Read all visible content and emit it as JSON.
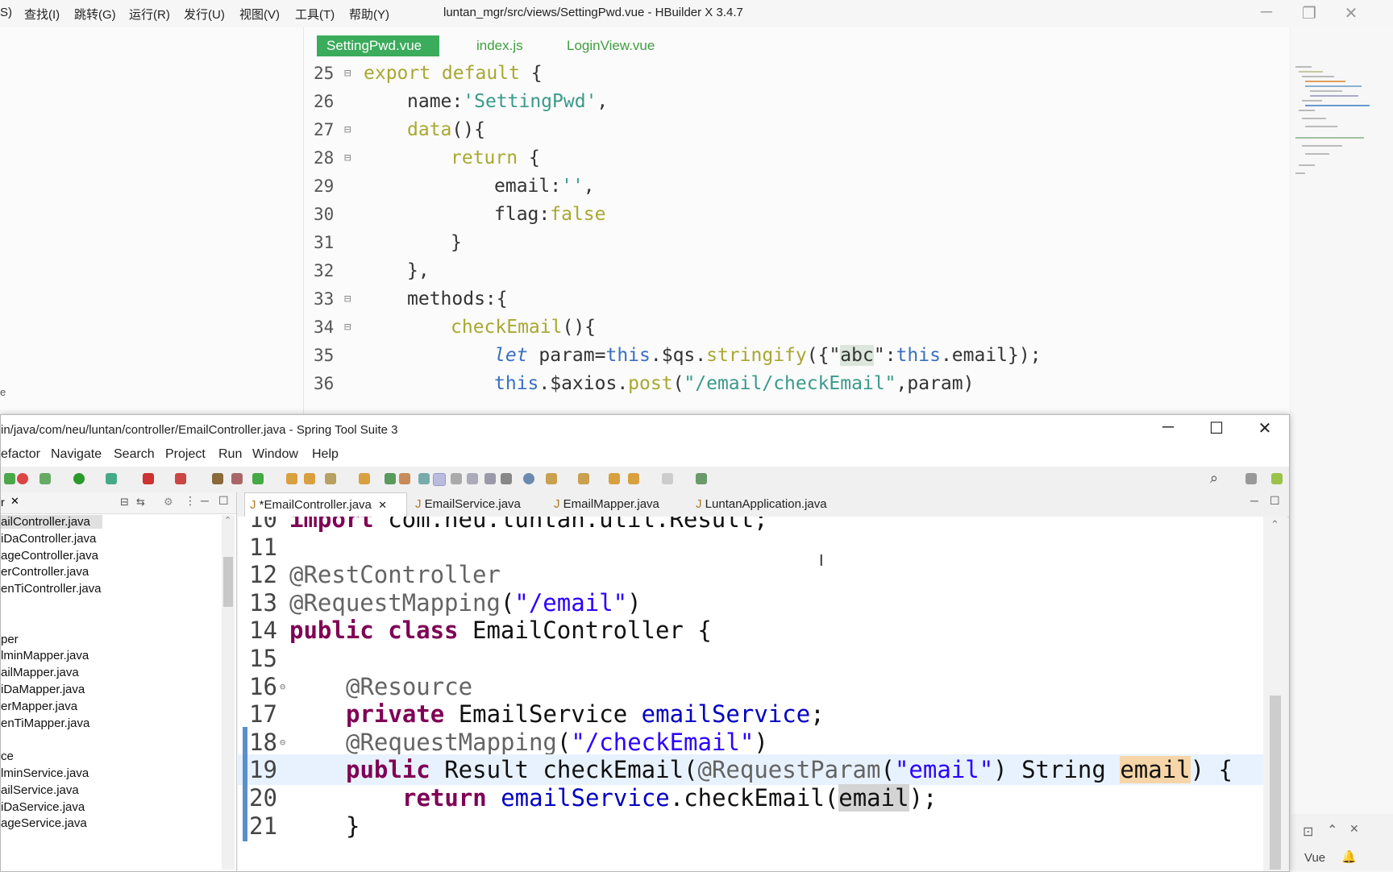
{
  "hbuilder": {
    "menu": [
      "S)",
      "查找(I)",
      "跳转(G)",
      "运行(R)",
      "发行(U)",
      "视图(V)",
      "工具(T)",
      "帮助(Y)"
    ],
    "title": "luntan_mgr/src/views/SettingPwd.vue - HBuilder X 3.4.7",
    "left_fragment": "e",
    "tabs": [
      "SettingPwd.vue",
      "index.js",
      "LoginView.vue"
    ],
    "lines": [
      {
        "n": "25",
        "fold": "⊟",
        "parts": [
          [
            "kw",
            "export default "
          ],
          [
            "t",
            "{"
          ]
        ],
        "indent": 0
      },
      {
        "n": "26",
        "fold": "",
        "parts": [
          [
            "t",
            "name:"
          ],
          [
            "str",
            "'SettingPwd'"
          ],
          [
            "t",
            ","
          ]
        ],
        "indent": 1
      },
      {
        "n": "27",
        "fold": "⊟",
        "parts": [
          [
            "kw",
            "data"
          ],
          [
            "t",
            "(){"
          ]
        ],
        "indent": 1
      },
      {
        "n": "28",
        "fold": "⊟",
        "parts": [
          [
            "kw",
            "return "
          ],
          [
            "t",
            "{"
          ]
        ],
        "indent": 2
      },
      {
        "n": "29",
        "fold": "",
        "parts": [
          [
            "t",
            "email:"
          ],
          [
            "str",
            "''"
          ],
          [
            "t",
            ","
          ]
        ],
        "indent": 3
      },
      {
        "n": "30",
        "fold": "",
        "parts": [
          [
            "t",
            "flag:"
          ],
          [
            "kw",
            "false"
          ]
        ],
        "indent": 3
      },
      {
        "n": "31",
        "fold": "",
        "parts": [
          [
            "t",
            "}"
          ]
        ],
        "indent": 2
      },
      {
        "n": "32",
        "fold": "",
        "parts": [
          [
            "t",
            "},"
          ]
        ],
        "indent": 1
      },
      {
        "n": "33",
        "fold": "⊟",
        "parts": [
          [
            "t",
            "methods:{"
          ]
        ],
        "indent": 1
      },
      {
        "n": "34",
        "fold": "⊟",
        "parts": [
          [
            "kw",
            "checkEmail"
          ],
          [
            "t",
            "(){"
          ]
        ],
        "indent": 2
      },
      {
        "n": "35",
        "fold": "",
        "parts": [
          [
            "it",
            "let "
          ],
          [
            "t",
            "param="
          ],
          [
            "blue",
            "this"
          ],
          [
            "t",
            ".$qs."
          ],
          [
            "kw",
            "stringify"
          ],
          [
            "t",
            "({\""
          ],
          [
            "hl",
            "abc"
          ],
          [
            "t",
            "\":"
          ],
          [
            "blue",
            "this"
          ],
          [
            "t",
            ".email});"
          ]
        ],
        "indent": 3
      },
      {
        "n": "36",
        "fold": "",
        "parts": [
          [
            "blue",
            "this"
          ],
          [
            "t",
            ".$axios."
          ],
          [
            "kw",
            "post"
          ],
          [
            "t",
            "("
          ],
          [
            "str",
            "\"/email/checkEmail\""
          ],
          [
            "t",
            ",param)"
          ]
        ],
        "indent": 3
      }
    ],
    "status_lang": "Vue"
  },
  "sts": {
    "title": "in/java/com/neu/luntan/controller/EmailController.java - Spring Tool Suite 3",
    "menu": [
      "efactor",
      "Navigate",
      "Search",
      "Project",
      "Run",
      "Window",
      "Help"
    ],
    "left_tab_fragment": "r",
    "tree": [
      "ailController.java",
      "iDaController.java",
      "ageController.java",
      "erController.java",
      "enTiController.java",
      "",
      "",
      "per",
      "lminMapper.java",
      "ailMapper.java",
      "iDaMapper.java",
      "erMapper.java",
      "enTiMapper.java",
      "",
      "ce",
      "lminService.java",
      "ailService.java",
      "iDaService.java",
      "ageService.java"
    ],
    "tabs": [
      "*EmailController.java",
      "EmailService.java",
      "EmailMapper.java",
      "LuntanApplication.java"
    ],
    "lines": [
      {
        "n": "10",
        "parts": [
          [
            "kw",
            "import "
          ],
          [
            "t",
            "com.neu.luntan.util.Result;"
          ]
        ],
        "indent": 0
      },
      {
        "n": "11",
        "parts": [],
        "indent": 0
      },
      {
        "n": "12",
        "parts": [
          [
            "anno",
            "@RestController"
          ]
        ],
        "indent": 0
      },
      {
        "n": "13",
        "parts": [
          [
            "anno",
            "@RequestMapping"
          ],
          [
            "t",
            "("
          ],
          [
            "str",
            "\"/email\""
          ],
          [
            "t",
            ")"
          ]
        ],
        "indent": 0
      },
      {
        "n": "14",
        "parts": [
          [
            "kw",
            "public class "
          ],
          [
            "t",
            "EmailController {"
          ]
        ],
        "indent": 0
      },
      {
        "n": "15",
        "parts": [],
        "indent": 0
      },
      {
        "n": "16",
        "parts": [
          [
            "anno",
            "@Resource"
          ]
        ],
        "indent": 1
      },
      {
        "n": "17",
        "parts": [
          [
            "kw",
            "private "
          ],
          [
            "t",
            "EmailService "
          ],
          [
            "field",
            "emailService"
          ],
          [
            "t",
            ";"
          ]
        ],
        "indent": 1
      },
      {
        "n": "18",
        "parts": [
          [
            "anno",
            "@RequestMapping"
          ],
          [
            "t",
            "("
          ],
          [
            "str",
            "\"/checkEmail\""
          ],
          [
            "t",
            ")"
          ]
        ],
        "indent": 1
      },
      {
        "n": "19",
        "parts": [
          [
            "kw",
            "public "
          ],
          [
            "t",
            "Result checkEmail("
          ],
          [
            "anno",
            "@RequestParam"
          ],
          [
            "t",
            "("
          ],
          [
            "str",
            "\"email\""
          ],
          [
            "t",
            ") String "
          ],
          [
            "ph",
            "email"
          ],
          [
            "t",
            ") {"
          ]
        ],
        "indent": 1
      },
      {
        "n": "20",
        "parts": [
          [
            "kw",
            "return "
          ],
          [
            "field",
            "emailService"
          ],
          [
            "t",
            ".checkEmail("
          ],
          [
            "pg",
            "email"
          ],
          [
            "t",
            ");"
          ]
        ],
        "indent": 2
      },
      {
        "n": "21",
        "parts": [
          [
            "t",
            "}"
          ]
        ],
        "indent": 1
      }
    ]
  }
}
